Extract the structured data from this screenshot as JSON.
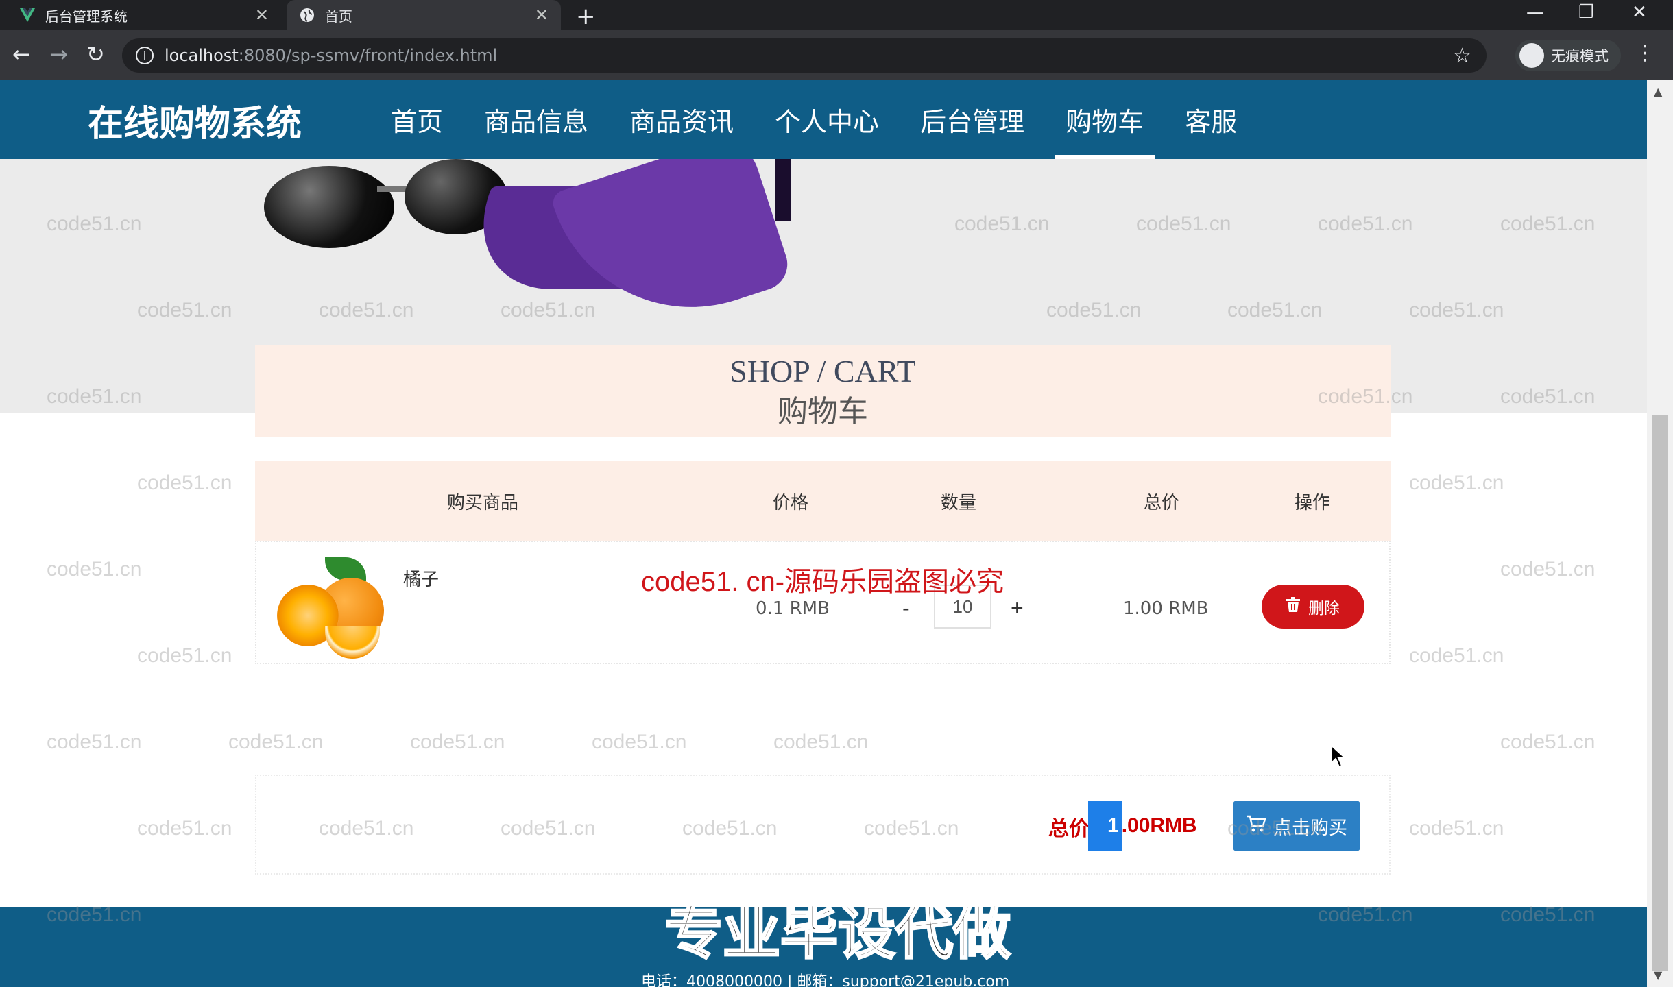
{
  "browser": {
    "tabs": [
      {
        "label": "后台管理系统",
        "favicon": "vue-icon",
        "active": false
      },
      {
        "label": "首页",
        "favicon": "globe-icon",
        "active": true
      }
    ],
    "url_host": "localhost",
    "url_path": ":8080/sp-ssmv/front/index.html",
    "profile_label": "无痕模式"
  },
  "header": {
    "brand": "在线购物系统",
    "nav": [
      "首页",
      "商品信息",
      "商品资讯",
      "个人中心",
      "后台管理",
      "购物车",
      "客服"
    ],
    "active_nav": "购物车",
    "color": "#0f5d87"
  },
  "banner": {
    "slide_count": 5,
    "active_slide": 1
  },
  "cart": {
    "title_en": "SHOP / CART",
    "title_zh": "购物车",
    "columns": [
      "购买商品",
      "价格",
      "数量",
      "总价",
      "操作"
    ],
    "items": [
      {
        "name": "橘子",
        "price": "0.1 RMB",
        "qty": "10",
        "total": "1.00 RMB",
        "delete_label": "删除"
      }
    ],
    "minus_label": "-",
    "plus_label": "+",
    "summary_label": "总价：",
    "summary_value_selected": "1",
    "summary_value_rest": ".00RMB",
    "buy_label": "点击购买"
  },
  "footer": {
    "contact": "电话：4008000000 | 邮箱：support@21epub.com"
  },
  "watermarks": {
    "tile": "code51.cn",
    "red": "code51. cn-源码乐园盗图必究",
    "big": "专业毕设代做"
  }
}
